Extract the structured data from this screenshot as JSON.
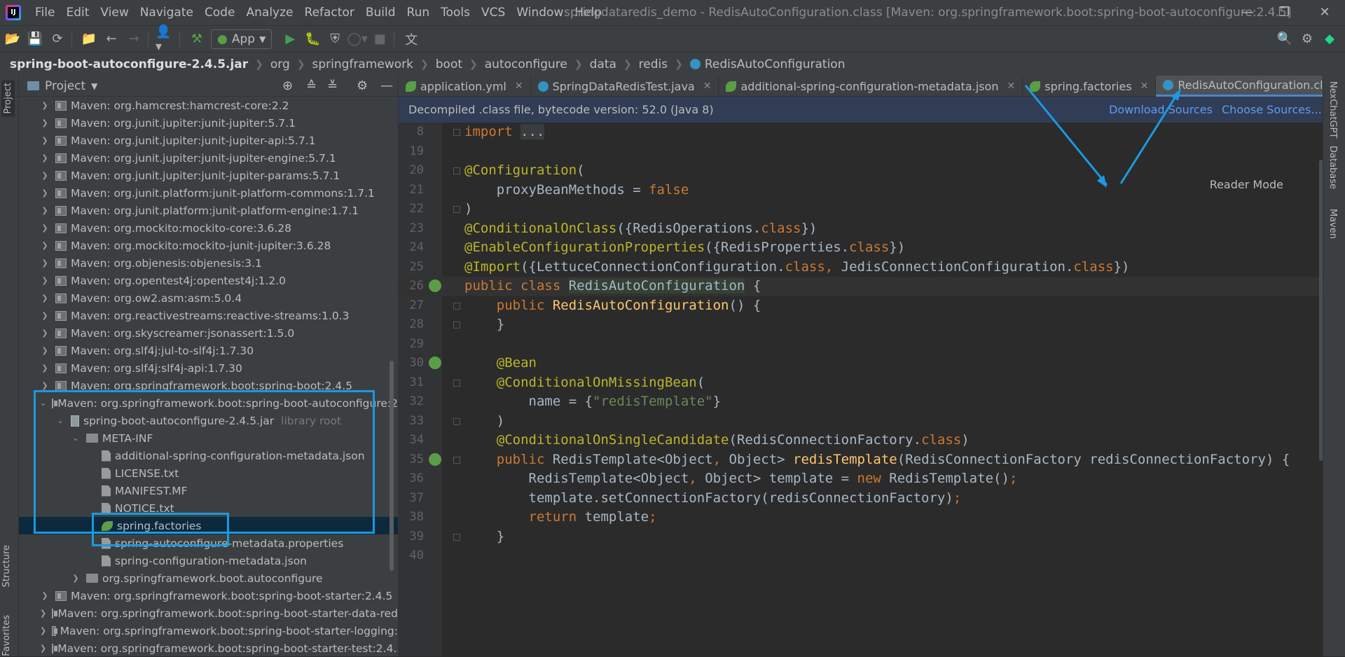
{
  "menu": [
    "File",
    "Edit",
    "View",
    "Navigate",
    "Code",
    "Analyze",
    "Refactor",
    "Build",
    "Run",
    "Tools",
    "VCS",
    "Window",
    "Help"
  ],
  "window_title": "springdataredis_demo - RedisAutoConfiguration.class [Maven: org.springframework.boot:spring-boot-autoconfigure:2.4.5]",
  "toolbar": {
    "run_config": "App"
  },
  "breadcrumb": [
    "spring-boot-autoconfigure-2.4.5.jar",
    "org",
    "springframework",
    "boot",
    "autoconfigure",
    "data",
    "redis",
    "RedisAutoConfiguration"
  ],
  "left_strip": {
    "project": "Project",
    "structure": "Structure",
    "favorites": "Favorites"
  },
  "project_panel": {
    "title": "Project",
    "rows": [
      "Maven: org.hamcrest:hamcrest-core:2.2",
      "Maven: org.junit.jupiter:junit-jupiter:5.7.1",
      "Maven: org.junit.jupiter:junit-jupiter-api:5.7.1",
      "Maven: org.junit.jupiter:junit-jupiter-engine:5.7.1",
      "Maven: org.junit.jupiter:junit-jupiter-params:5.7.1",
      "Maven: org.junit.platform:junit-platform-commons:1.7.1",
      "Maven: org.junit.platform:junit-platform-engine:1.7.1",
      "Maven: org.mockito:mockito-core:3.6.28",
      "Maven: org.mockito:mockito-junit-jupiter:3.6.28",
      "Maven: org.objenesis:objenesis:3.1",
      "Maven: org.opentest4j:opentest4j:1.2.0",
      "Maven: org.ow2.asm:asm:5.0.4",
      "Maven: org.reactivestreams:reactive-streams:1.0.3",
      "Maven: org.skyscreamer:jsonassert:1.5.0",
      "Maven: org.slf4j:jul-to-slf4j:1.7.30",
      "Maven: org.slf4j:slf4j-api:1.7.30",
      "Maven: org.springframework.boot:spring-boot:2.4.5",
      "Maven: org.springframework.boot:spring-boot-autoconfigure:2",
      "spring-boot-autoconfigure-2.4.5.jar",
      "META-INF",
      "additional-spring-configuration-metadata.json",
      "LICENSE.txt",
      "MANIFEST.MF",
      "NOTICE.txt",
      "spring.factories",
      "spring-autoconfigure-metadata.properties",
      "spring-configuration-metadata.json",
      "org.springframework.boot.autoconfigure",
      "Maven: org.springframework.boot:spring-boot-starter:2.4.5",
      "Maven: org.springframework.boot:spring-boot-starter-data-red",
      "Maven: org.springframework.boot:spring-boot-starter-logging:",
      "Maven: org.springframework.boot:spring-boot-starter-test:2.4.5"
    ],
    "library_root": "library root"
  },
  "tabs": [
    "application.yml",
    "SpringDataRedisTest.java",
    "additional-spring-configuration-metadata.json",
    "spring.factories",
    "RedisAutoConfiguration.class"
  ],
  "banner": {
    "text": "Decompiled .class file, bytecode version: 52.0 (Java 8)",
    "download": "Download Sources",
    "choose": "Choose Sources..."
  },
  "reader_mode": "Reader Mode",
  "line_numbers": [
    "8",
    "19",
    "20",
    "21",
    "22",
    "23",
    "24",
    "25",
    "26",
    "27",
    "28",
    "29",
    "30",
    "31",
    "32",
    "33",
    "34",
    "35",
    "36",
    "37",
    "38",
    "39",
    "40"
  ],
  "right_strip": {
    "chatgpt": "NexChatGPT",
    "database": "Database",
    "maven": "Maven"
  }
}
